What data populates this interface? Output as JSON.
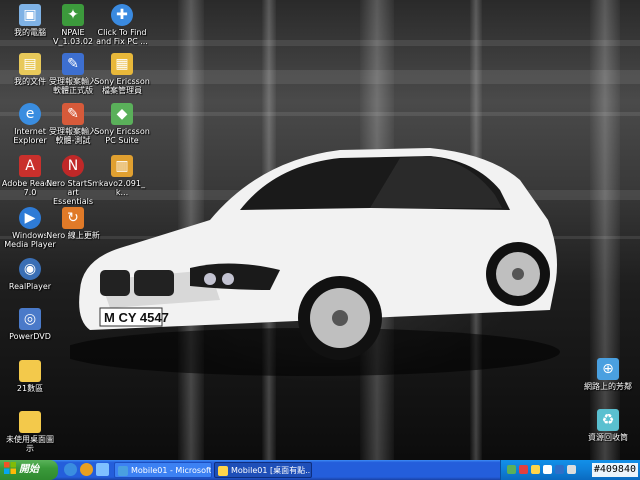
{
  "desktop": {
    "icons": [
      {
        "label": "我的電腦",
        "icon": "my-computer-icon",
        "color": "#7fb2e5"
      },
      {
        "label": "我的文件",
        "icon": "my-documents-icon",
        "color": "#e8c95a"
      },
      {
        "label": "Internet\nExplorer",
        "icon": "internet-explorer-icon",
        "color": "#3a8de0"
      },
      {
        "label": "Adobe Reader\n7.0",
        "icon": "adobe-reader-icon",
        "color": "#c9302c"
      },
      {
        "label": "Windows\nMedia Player",
        "icon": "media-player-icon",
        "color": "#2e7bd6"
      },
      {
        "label": "RealPlayer",
        "icon": "realplayer-icon",
        "color": "#3a6fb5"
      },
      {
        "label": "PowerDVD",
        "icon": "powerdvd-icon",
        "color": "#4a7ac9"
      },
      {
        "label": "21數區",
        "icon": "folder-icon",
        "color": "#f3c94b"
      },
      {
        "label": "未使用桌面圖\n示",
        "icon": "folder-icon",
        "color": "#f3c94b"
      },
      {
        "label": "NPAIE\nV_1.03.02",
        "icon": "npaie-icon",
        "color": "#3c9a3c"
      },
      {
        "label": "受理報案輸入\n軟體正式版",
        "icon": "report-software-icon",
        "color": "#3d6fd0"
      },
      {
        "label": "受理報案輸入\n軟體-測試",
        "icon": "report-test-icon",
        "color": "#d65a3a"
      },
      {
        "label": "Nero StartSmart\nEssentials",
        "icon": "nero-icon",
        "color": "#c02828"
      },
      {
        "label": "Nero 線上更新",
        "icon": "nero-update-icon",
        "color": "#e07a28"
      },
      {
        "label": "Click To Find\nand Fix PC ...",
        "icon": "fix-pc-icon",
        "color": "#3a8ae0"
      },
      {
        "label": "Sony Ericsson\n檔案管理員",
        "icon": "sony-ericsson-file-icon",
        "color": "#e8b83a"
      },
      {
        "label": "Sony Ericsson\nPC Suite",
        "icon": "sony-ericsson-suite-icon",
        "color": "#5ab05a"
      },
      {
        "label": "kavo2.091_k...",
        "icon": "archive-icon",
        "color": "#e0a030"
      },
      {
        "label": "網路上的芳鄰",
        "icon": "network-places-icon",
        "color": "#4aa0e0"
      },
      {
        "label": "資源回收筒",
        "icon": "recycle-bin-icon",
        "color": "#5ac0d0"
      }
    ],
    "car_plate": "M CY 4547"
  },
  "taskbar": {
    "start_label": "開始",
    "tasks": [
      {
        "label": "Mobile01 - Microsoft I..."
      },
      {
        "label": "Mobile01 [桌面有點..."
      }
    ],
    "clock": "#409840"
  }
}
